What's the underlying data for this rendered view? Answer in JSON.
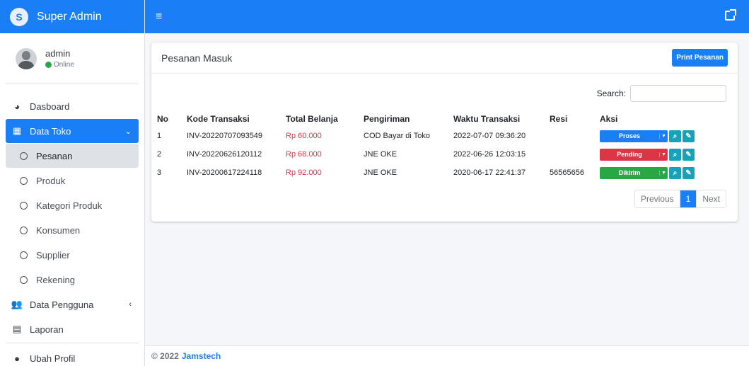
{
  "app": {
    "brand": "Super Admin"
  },
  "user": {
    "name": "admin",
    "status": "Online"
  },
  "nav": {
    "dashboard": "Dasboard",
    "data_toko": "Data Toko",
    "sub_items": [
      "Pesanan",
      "Produk",
      "Kategori Produk",
      "Konsumen",
      "Supplier",
      "Rekening"
    ],
    "data_pengguna": "Data Pengguna",
    "laporan": "Laporan",
    "ubah_profil": "Ubah Profil"
  },
  "card": {
    "title": "Pesanan Masuk",
    "print_button": "Print Pesanan",
    "search_label": "Search:"
  },
  "table": {
    "headers": [
      "No",
      "Kode Transaksi",
      "Total Belanja",
      "Pengiriman",
      "Waktu Transaksi",
      "Resi",
      "Aksi"
    ],
    "rows": [
      {
        "no": "1",
        "kode": "INV-20220707093549",
        "total": "Rp 60.000",
        "pengiriman": "COD Bayar di Toko",
        "waktu": "2022-07-07 09:36:20",
        "resi": "",
        "status": "Proses",
        "status_color": "#1a7ff5"
      },
      {
        "no": "2",
        "kode": "INV-20220626120112",
        "total": "Rp 68.000",
        "pengiriman": "JNE OKE",
        "waktu": "2022-06-26 12:03:15",
        "resi": "",
        "status": "Pending",
        "status_color": "#dc3545"
      },
      {
        "no": "3",
        "kode": "INV-20200617224118",
        "total": "Rp 92.000",
        "pengiriman": "JNE OKE",
        "waktu": "2020-06-17 22:41:37",
        "resi": "56565656",
        "status": "Dikirim",
        "status_color": "#28a745"
      }
    ]
  },
  "pagination": {
    "previous": "Previous",
    "current": "1",
    "next": "Next"
  },
  "footer": {
    "copyright": "© 2022",
    "brand": "Jamstech"
  },
  "colors": {
    "primary": "#1a7ff5",
    "danger": "#dc3545",
    "success": "#28a745",
    "info": "#17a2b8"
  }
}
